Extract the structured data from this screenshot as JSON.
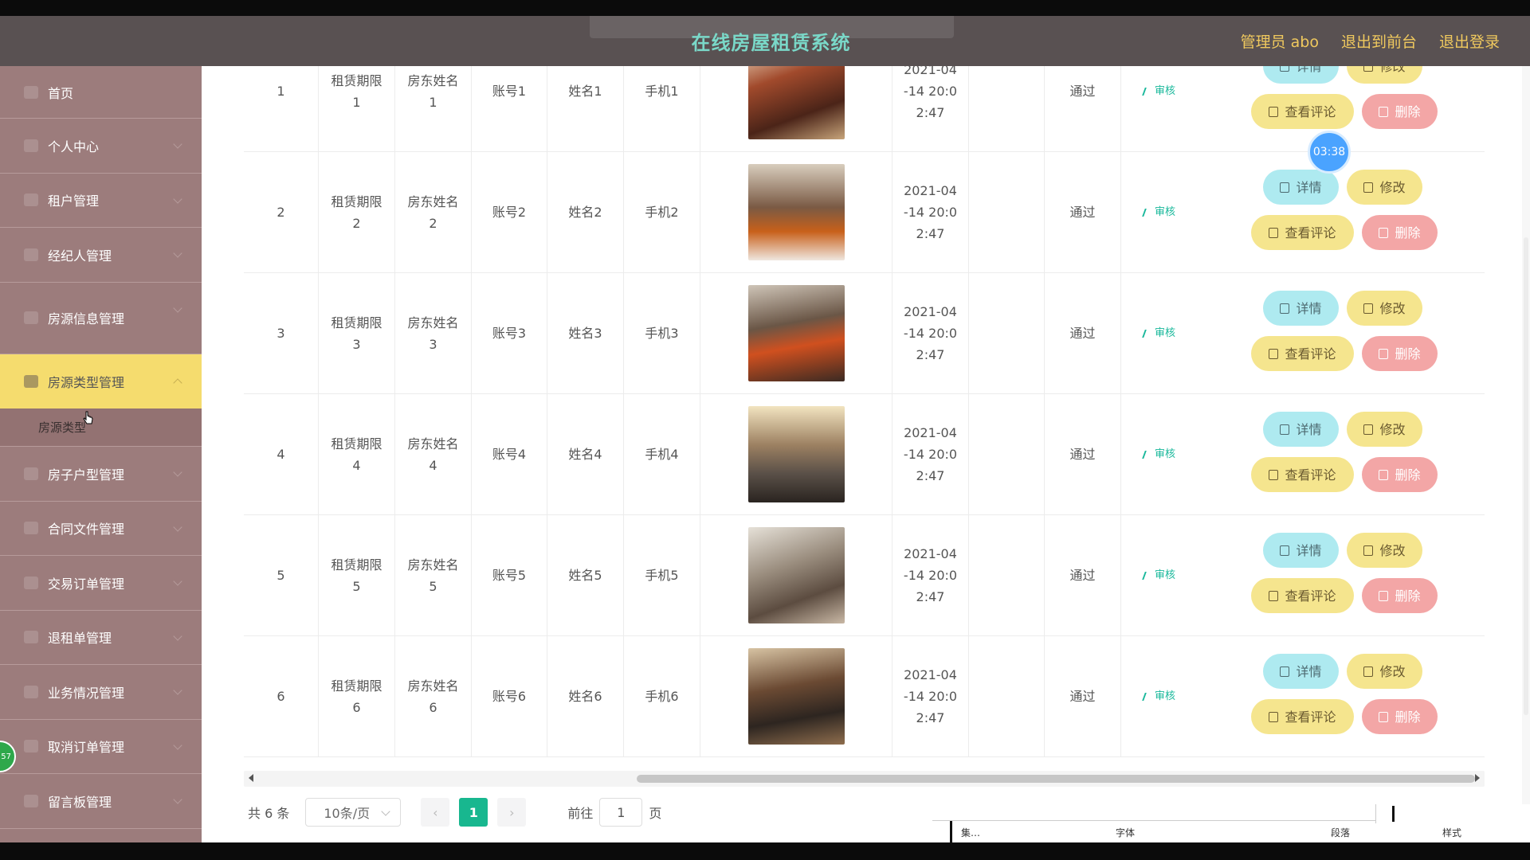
{
  "header": {
    "title": "在线房屋租赁系统",
    "links": [
      "管理员 abo",
      "退出到前台",
      "退出登录"
    ]
  },
  "sidebar": {
    "items": [
      {
        "label": "首页"
      },
      {
        "label": "个人中心"
      },
      {
        "label": "租户管理"
      },
      {
        "label": "经纪人管理"
      },
      {
        "label": "房源信息管理"
      },
      {
        "label": "房源类型管理"
      },
      {
        "label": "房子户型管理"
      },
      {
        "label": "合同文件管理"
      },
      {
        "label": "交易订单管理"
      },
      {
        "label": "退租单管理"
      },
      {
        "label": "业务情况管理"
      },
      {
        "label": "取消订单管理"
      },
      {
        "label": "留言板管理"
      }
    ],
    "submenu_label": "房源类型"
  },
  "table": {
    "rows": [
      {
        "idx": "1",
        "term_a": "租赁期限",
        "term_b": "1",
        "lname_a": "房东姓名",
        "lname_b": "1",
        "account": "账号1",
        "name": "姓名1",
        "phone": "手机1",
        "time_a": "2021-04",
        "time_b": "-14 20:0",
        "time_c": "2:47",
        "status": "通过",
        "audit": "审核"
      },
      {
        "idx": "2",
        "term_a": "租赁期限",
        "term_b": "2",
        "lname_a": "房东姓名",
        "lname_b": "2",
        "account": "账号2",
        "name": "姓名2",
        "phone": "手机2",
        "time_a": "2021-04",
        "time_b": "-14 20:0",
        "time_c": "2:47",
        "status": "通过",
        "audit": "审核"
      },
      {
        "idx": "3",
        "term_a": "租赁期限",
        "term_b": "3",
        "lname_a": "房东姓名",
        "lname_b": "3",
        "account": "账号3",
        "name": "姓名3",
        "phone": "手机3",
        "time_a": "2021-04",
        "time_b": "-14 20:0",
        "time_c": "2:47",
        "status": "通过",
        "audit": "审核"
      },
      {
        "idx": "4",
        "term_a": "租赁期限",
        "term_b": "4",
        "lname_a": "房东姓名",
        "lname_b": "4",
        "account": "账号4",
        "name": "姓名4",
        "phone": "手机4",
        "time_a": "2021-04",
        "time_b": "-14 20:0",
        "time_c": "2:47",
        "status": "通过",
        "audit": "审核"
      },
      {
        "idx": "5",
        "term_a": "租赁期限",
        "term_b": "5",
        "lname_a": "房东姓名",
        "lname_b": "5",
        "account": "账号5",
        "name": "姓名5",
        "phone": "手机5",
        "time_a": "2021-04",
        "time_b": "-14 20:0",
        "time_c": "2:47",
        "status": "通过",
        "audit": "审核"
      },
      {
        "idx": "6",
        "term_a": "租赁期限",
        "term_b": "6",
        "lname_a": "房东姓名",
        "lname_b": "6",
        "account": "账号6",
        "name": "姓名6",
        "phone": "手机6",
        "time_a": "2021-04",
        "time_b": "-14 20:0",
        "time_c": "2:47",
        "status": "通过",
        "audit": "审核"
      }
    ],
    "buttons": {
      "detail": "详情",
      "edit": "修改",
      "review": "查看评论",
      "delete": "删除"
    }
  },
  "timer": "03:38",
  "pagination": {
    "total": "共 6 条",
    "page_size": "10条/页",
    "current": "1",
    "goto_label": "前往",
    "goto_value": "1",
    "page_suffix": "页"
  },
  "overlay": {
    "badge": "57"
  },
  "taskbar": {
    "t1": "集…",
    "t2": "字体",
    "t3": "段落",
    "t4": "样式"
  },
  "colors": {
    "header_bg": "#595152",
    "title": "#7ad8c8",
    "link": "#f0c95e",
    "sidebar_bg": "#9c7c7c",
    "sidebar_active": "#f5dc6e",
    "page_current": "#18b78f"
  }
}
